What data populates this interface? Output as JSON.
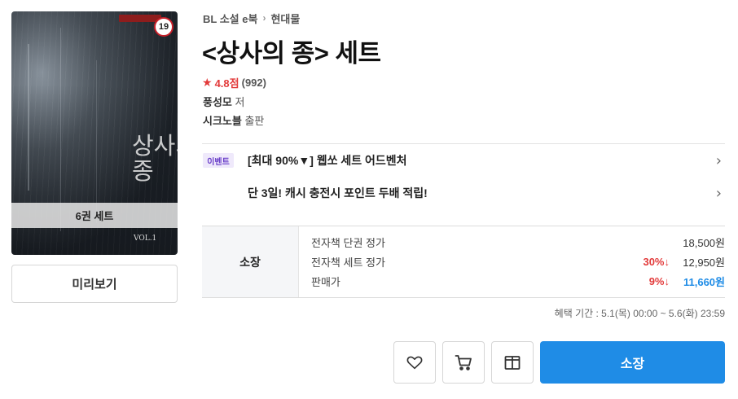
{
  "cover": {
    "age_badge": "19",
    "set_label": "6권 세트",
    "art_title": "상사의 종",
    "art_volume": "VOL.1"
  },
  "preview_button": "미리보기",
  "breadcrumb": {
    "category": "BL 소설 e북",
    "separator": "›",
    "subcategory": "현대물"
  },
  "title": "<상사의 종> 세트",
  "rating": {
    "star_icon": "star-icon",
    "score": "4.8점",
    "count": "(992)"
  },
  "author": {
    "name": "풍성모",
    "suffix": "저"
  },
  "publisher": {
    "name": "시크노블",
    "suffix": "출판"
  },
  "events": [
    {
      "badge": "이벤트",
      "text": "[최대 90%▼] 웹쏘 세트 어드벤처",
      "arrow": "›"
    },
    {
      "badge": "",
      "text": "단 3일! 캐시 충전시 포인트 두배 적립!",
      "arrow": "›"
    }
  ],
  "price": {
    "label": "소장",
    "rows": [
      {
        "name": "전자책 단권 정가",
        "discount": "",
        "value": "18,500원"
      },
      {
        "name": "전자책 세트 정가",
        "discount": "30%↓",
        "value": "12,950원"
      },
      {
        "name": "판매가",
        "discount": "9%↓",
        "value": "11,660원"
      }
    ]
  },
  "benefit_period": "혜택 기간 : 5.1(목) 00:00 ~ 5.6(화) 23:59",
  "actions": {
    "wishlist_icon": "heart-icon",
    "cart_icon": "cart-icon",
    "gift_icon": "gift-icon",
    "buy_label": "소장"
  },
  "colors": {
    "accent": "#1f8ce6",
    "discount": "#e23a3a",
    "event_badge_bg": "#efe9fb",
    "event_badge_text": "#6a3fc9",
    "age_badge_border": "#c8202a"
  }
}
